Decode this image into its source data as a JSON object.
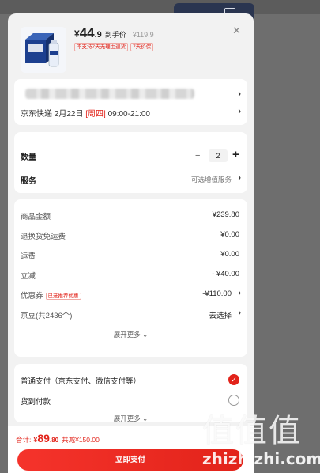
{
  "product": {
    "currency": "¥",
    "price_int": "44",
    "price_dec": ".9",
    "price_label": "到手价",
    "original_price": "¥119.9",
    "tags": [
      "不支持7天无理由退货",
      "7天价保"
    ]
  },
  "delivery": {
    "shipping_prefix": "京东快递 2月22日 ",
    "weekday": "[周四]",
    "time": " 09:00-21:00"
  },
  "options": {
    "quantity_label": "数量",
    "minus": "−",
    "quantity": "2",
    "plus": "+",
    "service_label": "服务",
    "service_value": "可选增值服务"
  },
  "summary": {
    "rows": [
      {
        "label": "商品金额",
        "value": "¥239.80"
      },
      {
        "label": "退换货免运费",
        "value": "¥0.00"
      },
      {
        "label": "运费",
        "value": "¥0.00"
      },
      {
        "label": "立减",
        "value": "- ¥40.00"
      },
      {
        "label": "优惠券",
        "badge": "已选推荐优惠",
        "value": "-¥110.00"
      },
      {
        "label": "京豆(共2436个)",
        "value": "去选择"
      }
    ],
    "expand": "展开更多"
  },
  "payment": {
    "options": [
      {
        "label": "普通支付（京东支付、微信支付等）",
        "selected": true
      },
      {
        "label": "货到付款",
        "selected": false
      }
    ],
    "expand": "展开更多"
  },
  "footer": {
    "total_label": "合计:",
    "currency": "¥",
    "total_int": "89",
    "total_dec": ".80",
    "total_sum": "共减¥150.00",
    "pay_button": "立即支付"
  },
  "watermark": {
    "logo": "值值值",
    "url": "zhizhizhi.com"
  },
  "icons": {
    "close": "close-icon",
    "chevron": "chevron-right-icon",
    "check": "check-icon"
  },
  "colors": {
    "accent": "#e2231a"
  }
}
